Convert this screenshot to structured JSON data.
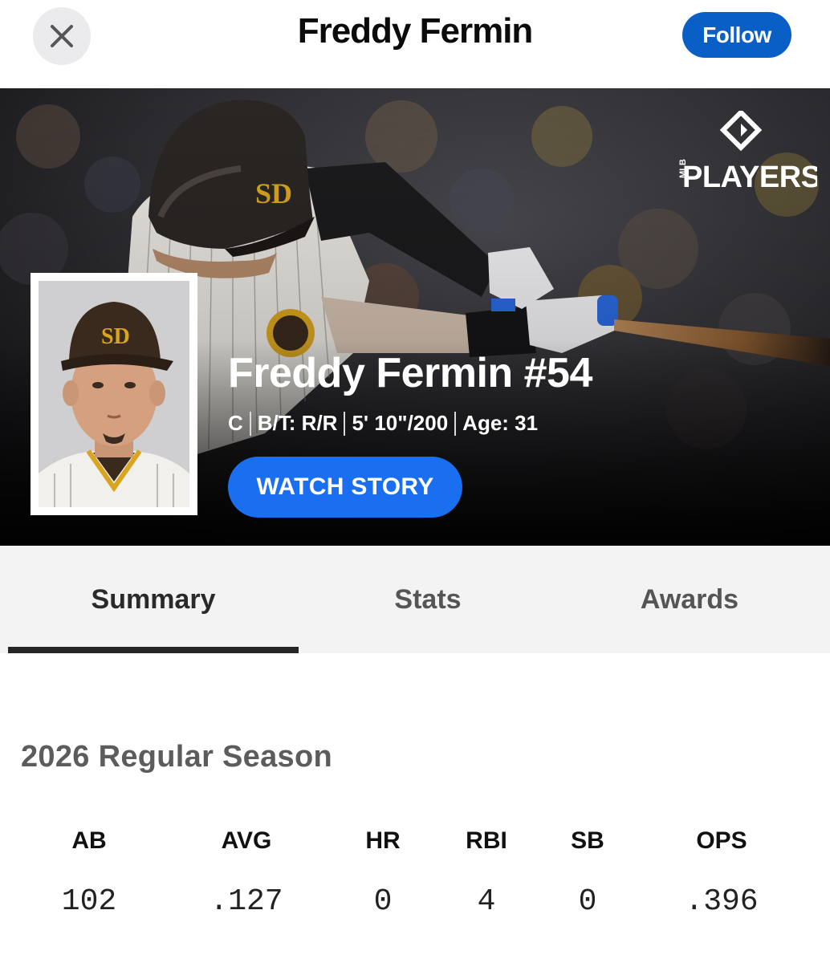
{
  "header": {
    "title": "Freddy Fermin",
    "follow_label": "Follow"
  },
  "hero": {
    "logo_small": "MLB",
    "logo_text": "PLAYERS",
    "player_name": "Freddy Fermin #54",
    "position": "C",
    "bats_throws": "B/T: R/R",
    "height_weight": "5' 10\"/200",
    "age": "Age: 31",
    "watch_label": "WATCH STORY",
    "cap_logo": "SD"
  },
  "tabs": [
    {
      "label": "Summary",
      "active": true
    },
    {
      "label": "Stats",
      "active": false
    },
    {
      "label": "Awards",
      "active": false
    }
  ],
  "season": {
    "title": "2026 Regular Season",
    "headers": [
      "AB",
      "AVG",
      "HR",
      "RBI",
      "SB",
      "OPS"
    ],
    "values": [
      "102",
      ".127",
      "0",
      "4",
      "0",
      ".396"
    ]
  },
  "colors": {
    "follow_bg": "#0a5fc7",
    "watch_bg": "#1a6ff0",
    "padres_brown": "#3a2a1d",
    "padres_gold": "#d9a521"
  }
}
